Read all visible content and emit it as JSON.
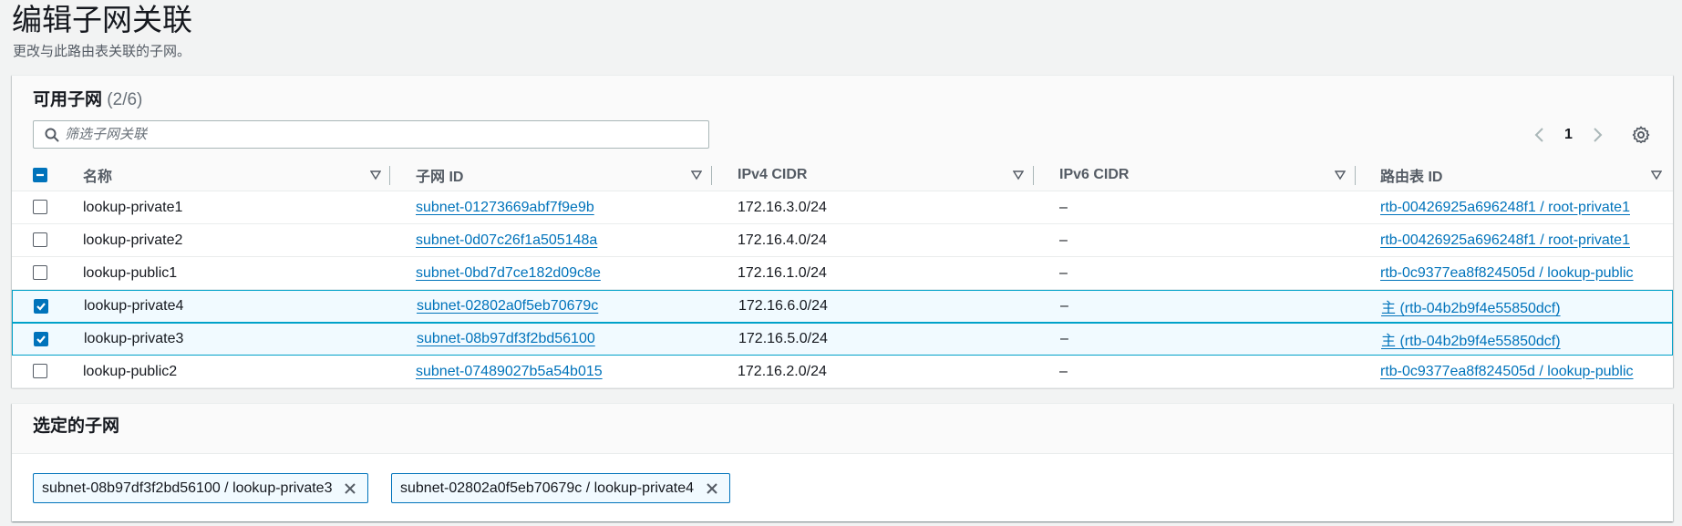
{
  "page": {
    "title": "编辑子网关联",
    "description": "更改与此路由表关联的子网。"
  },
  "available": {
    "heading": "可用子网",
    "count": "(2/6)",
    "search_placeholder": "筛选子网关联",
    "page_number": "1",
    "columns": [
      "名称",
      "子网 ID",
      "IPv4 CIDR",
      "IPv6 CIDR",
      "路由表 ID"
    ],
    "rows": [
      {
        "name": "lookup-private1",
        "subnet_id": "subnet-01273669abf7f9e9b",
        "ipv4": "172.16.3.0/24",
        "ipv6": "–",
        "route_table": "rtb-00426925a696248f1 / root-private1",
        "checked": false
      },
      {
        "name": "lookup-private2",
        "subnet_id": "subnet-0d07c26f1a505148a",
        "ipv4": "172.16.4.0/24",
        "ipv6": "–",
        "route_table": "rtb-00426925a696248f1 / root-private1",
        "checked": false
      },
      {
        "name": "lookup-public1",
        "subnet_id": "subnet-0bd7d7ce182d09c8e",
        "ipv4": "172.16.1.0/24",
        "ipv6": "–",
        "route_table": "rtb-0c9377ea8f824505d / lookup-public",
        "checked": false
      },
      {
        "name": "lookup-private4",
        "subnet_id": "subnet-02802a0f5eb70679c",
        "ipv4": "172.16.6.0/24",
        "ipv6": "–",
        "route_table": "主 (rtb-04b2b9f4e55850dcf)",
        "checked": true
      },
      {
        "name": "lookup-private3",
        "subnet_id": "subnet-08b97df3f2bd56100",
        "ipv4": "172.16.5.0/24",
        "ipv6": "–",
        "route_table": "主 (rtb-04b2b9f4e55850dcf)",
        "checked": true
      },
      {
        "name": "lookup-public2",
        "subnet_id": "subnet-07489027b5a54b015",
        "ipv4": "172.16.2.0/24",
        "ipv6": "–",
        "route_table": "rtb-0c9377ea8f824505d / lookup-public",
        "checked": false
      }
    ]
  },
  "selected": {
    "heading": "选定的子网",
    "chips": [
      "subnet-08b97df3f2bd56100 / lookup-private3",
      "subnet-02802a0f5eb70679c / lookup-private4"
    ]
  },
  "colors": {
    "accent": "#0073bb",
    "selected_row_bg": "#f1faff",
    "selected_row_border": "#00a1c9"
  }
}
